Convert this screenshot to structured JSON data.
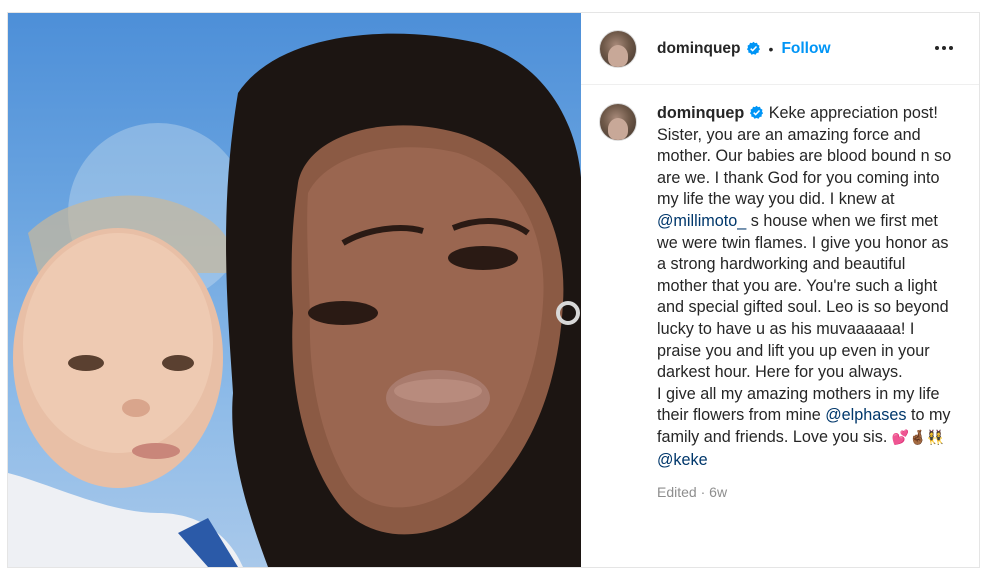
{
  "post": {
    "username": "dominquep",
    "follow_label": "Follow",
    "separator": "•",
    "more_icon": "more-horizontal-icon"
  },
  "caption": {
    "username": "dominquep",
    "p1": "Keke appreciation post! Sister, you are an amazing force and mother. Our babies are blood bound n so are we. I thank God for you coming into my life the way you did. I knew at ",
    "mention1": "@millimoto_",
    "p2": " s house when we first met we were twin flames. I give you honor as a strong hardworking and beautiful mother that you are. You're such a light and special gifted soul. Leo is so beyond lucky to have u as his muvaaaaaa! I praise you and lift you up even in your darkest hour. Here for you always.",
    "p3": "I give all my amazing mothers in my life their flowers from mine ",
    "mention2": "@elphases",
    "p4": " to my family and friends. Love you sis. ",
    "emojis": "💕🤞🏾👯‍♀️",
    "mention3": "@keke",
    "edited": "Edited",
    "time_sep": " · ",
    "time": "6w"
  },
  "colors": {
    "link": "#00376b",
    "follow": "#0095f6",
    "verified": "#0095f6",
    "meta": "#8e8e8e"
  }
}
